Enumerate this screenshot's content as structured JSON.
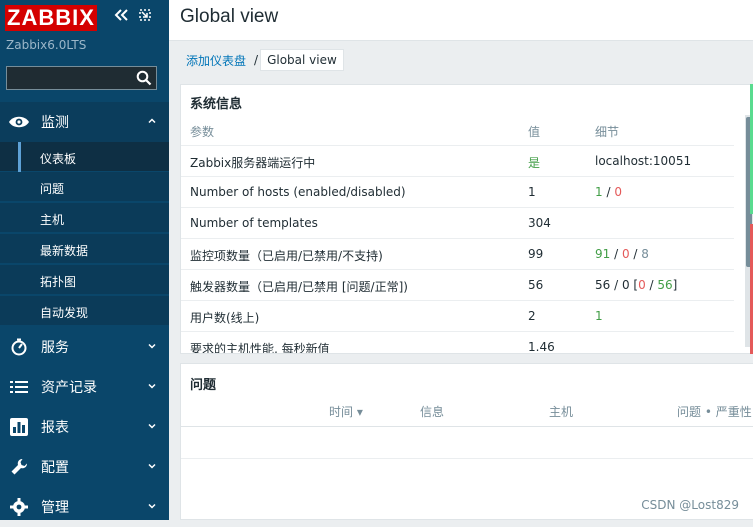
{
  "brand": {
    "logo_text": "ZABBIX",
    "server_name": "Zabbix6.0LTS"
  },
  "sidebar": {
    "search_placeholder": "",
    "sections": [
      {
        "label": "监测",
        "icon": "eye-icon",
        "expanded": true,
        "items": [
          {
            "label": "仪表板",
            "active": true
          },
          {
            "label": "问题"
          },
          {
            "label": "主机"
          },
          {
            "label": "最新数据"
          },
          {
            "label": "拓扑图"
          },
          {
            "label": "自动发现"
          }
        ]
      },
      {
        "label": "服务",
        "icon": "services-icon"
      },
      {
        "label": "资产记录",
        "icon": "list-icon"
      },
      {
        "label": "报表",
        "icon": "report-icon"
      },
      {
        "label": "配置",
        "icon": "wrench-icon"
      },
      {
        "label": "管理",
        "icon": "gear-icon"
      }
    ]
  },
  "page": {
    "title": "Global view"
  },
  "breadcrumb": {
    "parent": "添加仪表盘",
    "separator": "/",
    "current": "Global view"
  },
  "system_info": {
    "title": "系统信息",
    "columns": [
      "参数",
      "值",
      "细节"
    ],
    "rows": [
      {
        "param": "Zabbix服务器端运行中",
        "value": "是",
        "details": "localhost:10051"
      },
      {
        "param": "Number of hosts (enabled/disabled)",
        "value": "1",
        "d_a": "1",
        "d_sep": " / ",
        "d_b": "0"
      },
      {
        "param": "Number of templates",
        "value": "304",
        "details": ""
      },
      {
        "param": "监控项数量（已启用/已禁用/不支持)",
        "value": "99",
        "d_a": "91",
        "d_sep1": " / ",
        "d_b": "0",
        "d_sep2": " / ",
        "d_c": "8"
      },
      {
        "param": "触发器数量（已启用/已禁用 [问题/正常])",
        "value": "56",
        "d_pre": "56 / 0 [",
        "d_a": "0",
        "d_sep": " / ",
        "d_b": "56",
        "d_post": "]"
      },
      {
        "param": "用户数(线上)",
        "value": "2",
        "details": "1"
      },
      {
        "param": "要求的主机性能, 每秒新值",
        "value": "1.46",
        "details": ""
      }
    ]
  },
  "problems": {
    "title": "问题",
    "columns": {
      "time": "时间",
      "info": "信息",
      "host": "主机",
      "problem": "问题 • 严重性"
    }
  },
  "watermark": "CSDN @Lost829",
  "colors": {
    "sidebar_bg": "#0a466a",
    "logo_red": "#d40000",
    "ok_green": "#429e47",
    "problem_red": "#e45959",
    "link_blue": "#0275b8"
  }
}
